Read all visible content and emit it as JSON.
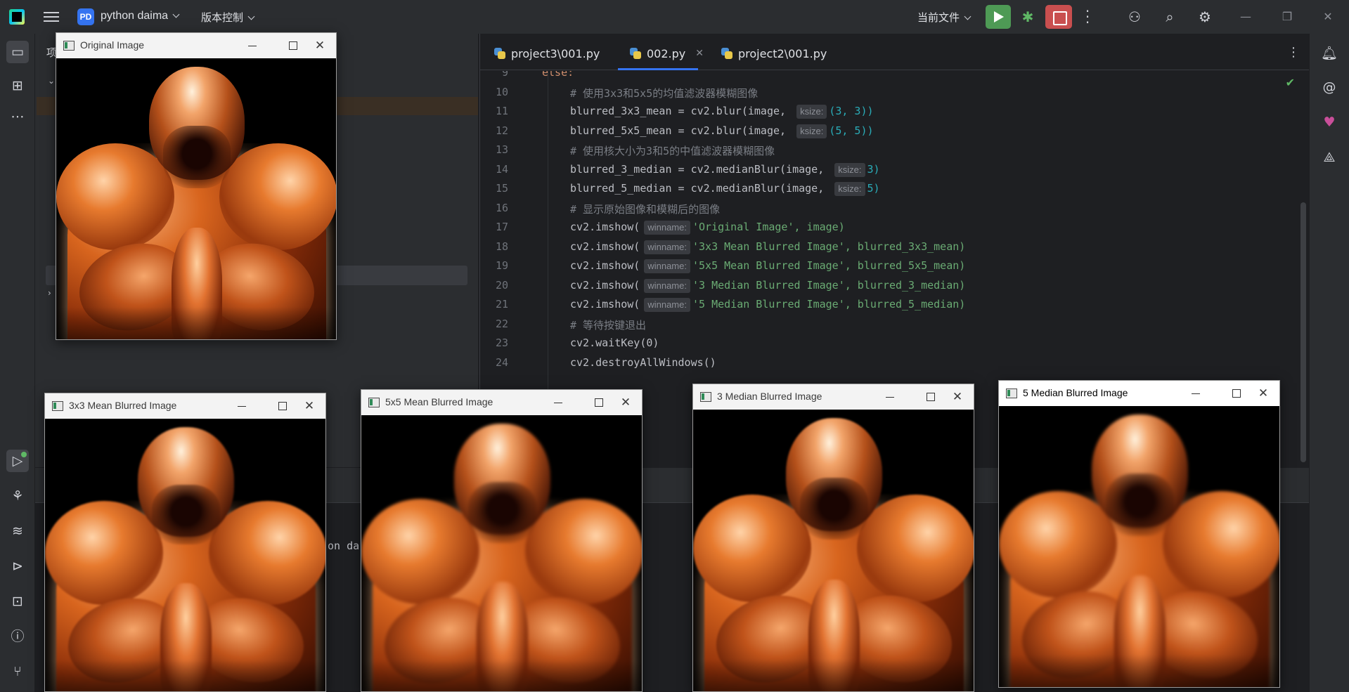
{
  "titlebar": {
    "project_badge": "PD",
    "project_name": "python daima",
    "vcs_label": "版本控制",
    "current_file_label": "当前文件"
  },
  "project_panel": {
    "title": "项"
  },
  "editor": {
    "tabs": [
      {
        "label": "project3\\001.py"
      },
      {
        "label": "002.py"
      },
      {
        "label": "project2\\001.py"
      }
    ],
    "active_tab_index": 1,
    "lines": [
      {
        "num": "9",
        "code": "else:"
      },
      {
        "num": "10",
        "code": "# 使用3x3和5x5的均值滤波器模糊图像"
      },
      {
        "num": "11",
        "code": "blurred_3x3_mean = cv2.blur(image, ",
        "hint": "ksize:",
        "rest": "(3, 3))"
      },
      {
        "num": "12",
        "code": "blurred_5x5_mean = cv2.blur(image, ",
        "hint": "ksize:",
        "rest": "(5, 5))"
      },
      {
        "num": "13",
        "code": "# 使用核大小为3和5的中值滤波器模糊图像"
      },
      {
        "num": "14",
        "code": "blurred_3_median = cv2.medianBlur(image, ",
        "hint": "ksize:",
        "rest": "3)"
      },
      {
        "num": "15",
        "code": "blurred_5_median = cv2.medianBlur(image, ",
        "hint": "ksize:",
        "rest": "5)"
      },
      {
        "num": "16",
        "code": "# 显示原始图像和模糊后的图像"
      },
      {
        "num": "17",
        "code": "cv2.imshow(",
        "hint": "winname:",
        "rest": "'Original Image', image)"
      },
      {
        "num": "18",
        "code": "cv2.imshow(",
        "hint": "winname:",
        "rest": "'3x3 Mean Blurred Image', blurred_3x3_mean)"
      },
      {
        "num": "19",
        "code": "cv2.imshow(",
        "hint": "winname:",
        "rest": "'5x5 Mean Blurred Image', blurred_5x5_mean)"
      },
      {
        "num": "20",
        "code": "cv2.imshow(",
        "hint": "winname:",
        "rest": "'3 Median Blurred Image', blurred_3_median)"
      },
      {
        "num": "21",
        "code": "cv2.imshow(",
        "hint": "winname:",
        "rest": "'5 Median Blurred Image', blurred_5_median)"
      },
      {
        "num": "22",
        "code": "# 等待按键退出"
      },
      {
        "num": "23",
        "code": "cv2.waitKey(0)"
      },
      {
        "num": "24",
        "code": "cv2.destroyAllWindows()"
      }
    ]
  },
  "console": {
    "visible_text": "on da"
  },
  "cv_windows": [
    {
      "title": "Original Image",
      "filter": "none"
    },
    {
      "title": "3x3 Mean Blurred Image",
      "filter": "blur-small"
    },
    {
      "title": "5x5 Mean Blurred Image",
      "filter": "blur-med"
    },
    {
      "title": "3 Median Blurred Image",
      "filter": "blur-small"
    },
    {
      "title": "5 Median Blurred Image",
      "filter": "blur-med"
    }
  ],
  "colors": {
    "accent": "#3574f0",
    "run_green": "#4e9a55",
    "stop_red": "#c94f4f",
    "string_green": "#6aab73",
    "number_cyan": "#2aacb8",
    "comment_gray": "#7a7e85"
  }
}
